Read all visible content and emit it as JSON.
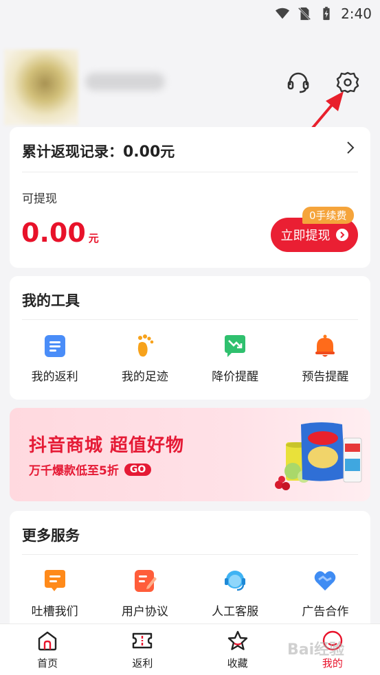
{
  "status_bar": {
    "time": "2:40",
    "icons": [
      "wifi-icon",
      "no-sim-icon",
      "battery-charging-icon"
    ]
  },
  "header": {
    "icons": [
      "headset-icon",
      "gear-icon"
    ]
  },
  "cash_card": {
    "title_prefix": "累计返现记录：",
    "title_amount": "0.00",
    "title_unit": "元",
    "withdraw_label": "可提现",
    "withdraw_amount": "0.00",
    "withdraw_unit": "元",
    "withdraw_button": "立即提现",
    "fee_badge": "0手续费"
  },
  "tools": {
    "title": "我的工具",
    "items": [
      {
        "label": "我的返利",
        "icon": "list-doc-icon"
      },
      {
        "label": "我的足迹",
        "icon": "footprint-icon"
      },
      {
        "label": "降价提醒",
        "icon": "price-drop-icon"
      },
      {
        "label": "预告提醒",
        "icon": "bell-icon"
      }
    ]
  },
  "banner": {
    "title": "抖音商城 超值好物",
    "subtitle": "万千爆款低至5折",
    "go_label": "GO"
  },
  "more_services": {
    "title": "更多服务",
    "items": [
      {
        "label": "吐槽我们",
        "icon": "feedback-chat-icon"
      },
      {
        "label": "用户协议",
        "icon": "agreement-icon"
      },
      {
        "label": "人工客服",
        "icon": "customer-service-icon"
      },
      {
        "label": "广告合作",
        "icon": "heart-handshake-icon"
      }
    ]
  },
  "tabbar": {
    "items": [
      {
        "label": "首页",
        "icon": "home-icon",
        "active": false
      },
      {
        "label": "返利",
        "icon": "ticket-icon",
        "active": false
      },
      {
        "label": "收藏",
        "icon": "star-icon",
        "active": false
      },
      {
        "label": "我的",
        "icon": "profile-icon",
        "active": true
      }
    ]
  },
  "colors": {
    "accent": "#e8122a",
    "fee_badge": "#f5a43b",
    "banner_bg": "#ffdbe1"
  },
  "watermark": "Bai经验"
}
